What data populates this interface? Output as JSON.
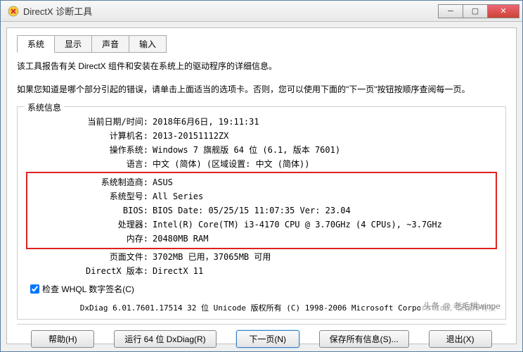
{
  "window": {
    "title": "DirectX 诊断工具"
  },
  "tabs": [
    "系统",
    "显示",
    "声音",
    "输入"
  ],
  "intro": {
    "p1": "该工具报告有关 DirectX 组件和安装在系统上的驱动程序的详细信息。",
    "p2": "如果您知道是哪个部分引起的错误，请单击上面适当的选项卡。否则，您可以使用下面的\"下一页\"按钮按顺序查阅每一页。"
  },
  "group_title": "系统信息",
  "rows": {
    "datetime": {
      "label": "当前日期/时间:",
      "value": "2018年6月6日, 19:11:31"
    },
    "computer": {
      "label": "计算机名:",
      "value": "2013-20151112ZX"
    },
    "os": {
      "label": "操作系统:",
      "value": "Windows 7 旗舰版 64 位 (6.1, 版本 7601)"
    },
    "lang": {
      "label": "语言:",
      "value": "中文 (简体) (区域设置: 中文 (简体))"
    },
    "mfr": {
      "label": "系统制造商:",
      "value": "ASUS"
    },
    "model": {
      "label": "系统型号:",
      "value": "All Series"
    },
    "bios": {
      "label": "BIOS:",
      "value": "BIOS Date: 05/25/15 11:07:35 Ver: 23.04"
    },
    "cpu": {
      "label": "处理器:",
      "value": "Intel(R) Core(TM) i3-4170 CPU @ 3.70GHz (4 CPUs), ~3.7GHz"
    },
    "mem": {
      "label": "内存:",
      "value": "20480MB RAM"
    },
    "page": {
      "label": "页面文件:",
      "value": "3702MB 已用，37065MB 可用"
    },
    "dx": {
      "label": "DirectX 版本:",
      "value": "DirectX 11"
    }
  },
  "whql": {
    "label": "检查 WHQL 数字签名(C)",
    "checked": true
  },
  "copyright": "DxDiag 6.01.7601.17514 32 位 Unicode 版权所有 (C) 1998-2006 Microsoft Corporation。保留所有权",
  "buttons": {
    "help": "帮助(H)",
    "run64": "运行 64 位 DxDiag(R)",
    "next": "下一页(N)",
    "save": "保存所有信息(S)...",
    "exit": "退出(X)"
  },
  "watermark": "头条 @ 老毛桃winpe"
}
